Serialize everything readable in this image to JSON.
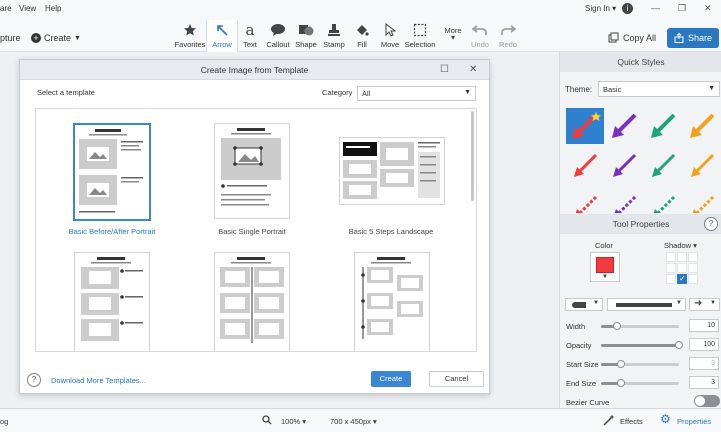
{
  "menu": {
    "items": [
      "are",
      "View",
      "Help"
    ]
  },
  "account": {
    "sign_in": "Sign In ▾",
    "info_icon": "info-icon"
  },
  "toolbar": {
    "capture": "pture",
    "create": "Create",
    "tools": [
      {
        "label": "Favorites",
        "icon": "star-icon"
      },
      {
        "label": "Arrow",
        "icon": "arrow-icon",
        "active": true
      },
      {
        "label": "Text",
        "icon": "text-icon"
      },
      {
        "label": "Callout",
        "icon": "callout-icon"
      },
      {
        "label": "Shape",
        "icon": "shape-icon"
      },
      {
        "label": "Stamp",
        "icon": "stamp-icon"
      },
      {
        "label": "Fill",
        "icon": "fill-icon"
      },
      {
        "label": "Move",
        "icon": "move-icon"
      },
      {
        "label": "Selection",
        "icon": "selection-icon"
      },
      {
        "label": "More",
        "icon": "more-icon"
      },
      {
        "label": "Undo",
        "icon": "undo-icon",
        "disabled": true
      },
      {
        "label": "Redo",
        "icon": "redo-icon",
        "disabled": true
      }
    ],
    "copy_all": "Copy All",
    "share": "Share"
  },
  "dialog": {
    "title": "Create Image from Template",
    "select_label": "Select a template",
    "category_label": "Category",
    "category_value": "All",
    "templates": [
      {
        "name": "Basic Before/After Portrait",
        "selected": true
      },
      {
        "name": "Basic Single Portrait"
      },
      {
        "name": "Basic 5 Steps Landscape"
      },
      {
        "name": ""
      },
      {
        "name": ""
      },
      {
        "name": ""
      }
    ],
    "help": "?",
    "download_link": "Download More Templates...",
    "create_button": "Create",
    "cancel_button": "Cancel"
  },
  "panel": {
    "quick_styles": "Quick Styles",
    "theme_label": "Theme:",
    "theme_value": "Basic",
    "style_colors": [
      "#f03c3c",
      "#7a2fbf",
      "#1fa37a",
      "#f0a21a"
    ],
    "tool_properties": "Tool Properties",
    "help": "?",
    "color_label": "Color",
    "shadow_label": "Shadow ▾",
    "selected_color": "#f03c3c",
    "width_label": "Width",
    "width_value": "10",
    "width_fraction": 0.2,
    "opacity_label": "Opacity",
    "opacity_value": "100",
    "opacity_fraction": 1.0,
    "start_size_label": "Start Size",
    "start_size_value": "3",
    "start_size_fraction": 0.25,
    "end_size_label": "End Size",
    "end_size_value": "3",
    "end_size_fraction": 0.25,
    "bezier_label": "Bezier Curve"
  },
  "status": {
    "left_text": "og",
    "zoom": "100% ▾",
    "dimensions": "700 x 450px ▾",
    "effects": "Effects",
    "properties": "Properties"
  }
}
